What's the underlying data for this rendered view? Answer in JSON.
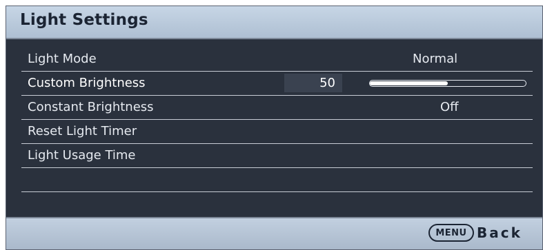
{
  "title": "Light Settings",
  "rows": [
    {
      "label": "Light Mode",
      "value": "Normal"
    },
    {
      "label": "Custom Brightness",
      "value": "50",
      "slider_level": 0.5
    },
    {
      "label": "Constant Brightness",
      "value": "Off"
    },
    {
      "label": "Reset Light Timer",
      "value": ""
    },
    {
      "label": "Light Usage Time",
      "value": ""
    },
    {
      "label": "",
      "value": ""
    }
  ],
  "footer": {
    "menu_key": "MENU",
    "back_label": "Back"
  },
  "colors": {
    "panel": "#2b323f",
    "titlebar": "#b8c8da",
    "text": "#e6eaf0",
    "divider": "#c9ced6"
  }
}
